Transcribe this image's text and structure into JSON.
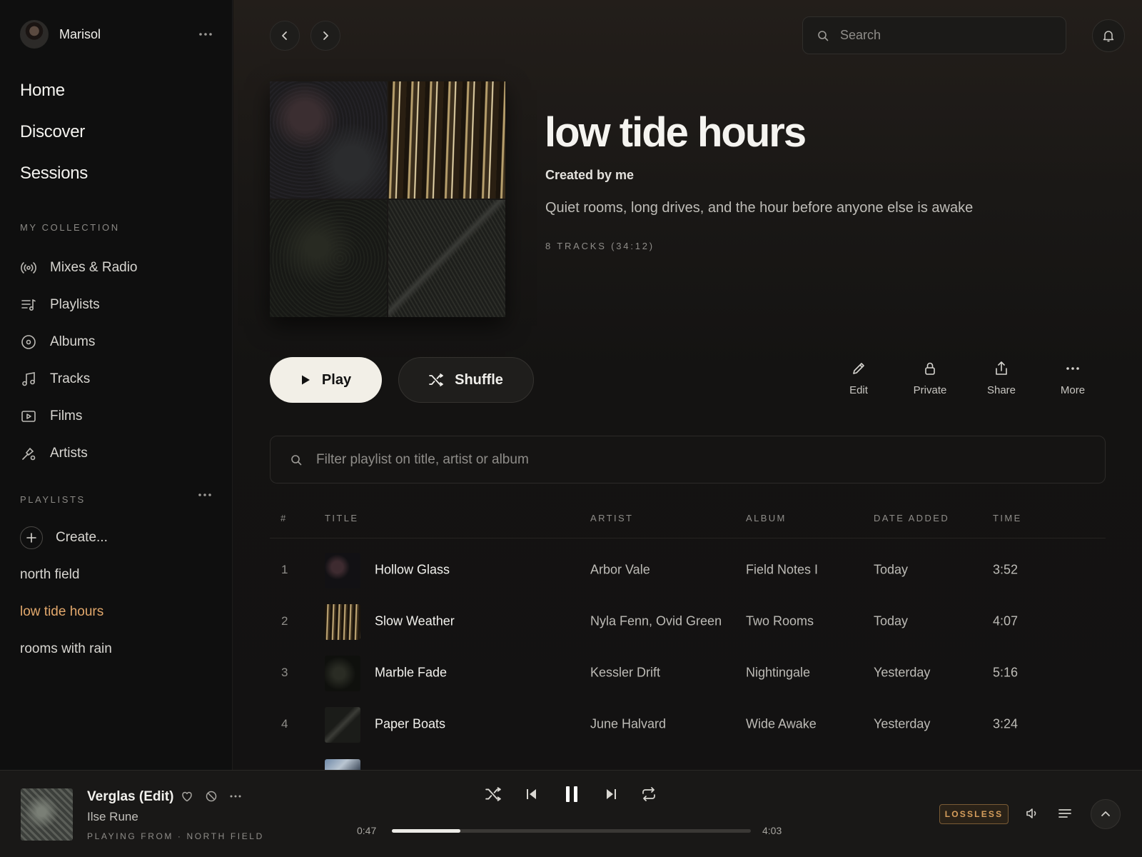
{
  "user": {
    "name": "Marisol"
  },
  "nav": {
    "items": [
      {
        "label": "Home"
      },
      {
        "label": "Discover"
      },
      {
        "label": "Sessions"
      }
    ]
  },
  "collection": {
    "title": "MY COLLECTION",
    "items": [
      {
        "label": "Mixes & Radio",
        "icon": "radio-icon"
      },
      {
        "label": "Playlists",
        "icon": "playlist-icon"
      },
      {
        "label": "Albums",
        "icon": "album-icon"
      },
      {
        "label": "Tracks",
        "icon": "music-note-icon"
      },
      {
        "label": "Films",
        "icon": "film-icon"
      },
      {
        "label": "Artists",
        "icon": "artist-icon"
      }
    ]
  },
  "playlists": {
    "title": "PLAYLISTS",
    "create_label": "Create...",
    "items": [
      {
        "label": "north field"
      },
      {
        "label": "low tide hours"
      },
      {
        "label": "rooms with rain"
      }
    ],
    "active_index": 1
  },
  "header": {
    "search_placeholder": "Search"
  },
  "playlist": {
    "title": "low tide hours",
    "creator": "Created by me",
    "description": "Quiet rooms, long drives, and the hour before anyone else is awake",
    "meta": "8 TRACKS (34:12)",
    "play_label": "Play",
    "shuffle_label": "Shuffle",
    "actions": [
      {
        "label": "Edit"
      },
      {
        "label": "Private"
      },
      {
        "label": "Share"
      },
      {
        "label": "More"
      }
    ],
    "filter_placeholder": "Filter playlist on title, artist or album"
  },
  "table": {
    "headers": {
      "num": "#",
      "title": "TITLE",
      "artist": "ARTIST",
      "album": "ALBUM",
      "date": "DATE ADDED",
      "time": "TIME"
    },
    "rows": [
      {
        "num": "1",
        "title": "Hollow Glass",
        "artist": "Arbor Vale",
        "album": "Field Notes I",
        "date": "Today",
        "time": "3:52"
      },
      {
        "num": "2",
        "title": "Slow Weather",
        "artist": "Nyla Fenn, Ovid Green",
        "album": "Two Rooms",
        "date": "Today",
        "time": "4:07"
      },
      {
        "num": "3",
        "title": "Marble Fade",
        "artist": "Kessler Drift",
        "album": "Nightingale",
        "date": "Yesterday",
        "time": "5:16"
      },
      {
        "num": "4",
        "title": "Paper Boats",
        "artist": "June Halvard",
        "album": "Wide Awake",
        "date": "Yesterday",
        "time": "3:24"
      }
    ]
  },
  "player": {
    "title": "Verglas (Edit)",
    "artist": "Ilse Rune",
    "source": "PLAYING FROM · NORTH FIELD",
    "current_time": "0:47",
    "total_time": "4:03",
    "progress": 0.19,
    "quality": "LOSSLESS"
  },
  "colors": {
    "accent": "#e2a86c",
    "background": "#131212",
    "lossless": "#d69e5c"
  }
}
